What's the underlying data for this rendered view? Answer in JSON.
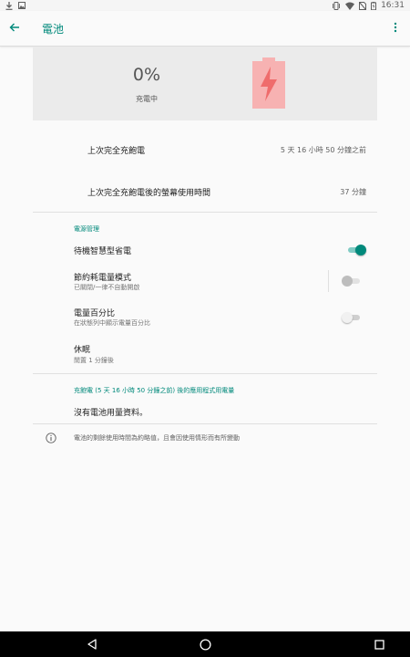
{
  "status_bar": {
    "time": "16:31",
    "icons_left": [
      "download-icon",
      "image-icon"
    ],
    "icons_right": [
      "vibrate-icon",
      "wifi-icon",
      "no-sim-icon",
      "battery-icon"
    ]
  },
  "app_bar": {
    "title": "電池",
    "accent_color": "#00897b"
  },
  "battery_header": {
    "percent": "0%",
    "status": "充電中",
    "icon": "battery-charging-icon",
    "level_fraction": 0
  },
  "usage": {
    "last_full_charge_label": "上次完全充飽電",
    "last_full_charge_value": "5 天 16 小時 50 分鐘之前",
    "screen_usage_label": "上次完全充飽電後的螢幕使用時間",
    "screen_usage_value": "37 分鐘"
  },
  "power_management": {
    "section_title": "電源管理",
    "items": [
      {
        "title": "待機智慧型省電",
        "summary": "",
        "switch": "on"
      },
      {
        "title": "節約耗電量模式",
        "summary": "已關閉/一律不自動開啟",
        "switch": "disabled"
      },
      {
        "title": "電量百分比",
        "summary": "在狀態列中顯示電量百分比",
        "switch": "off"
      },
      {
        "title": "休眠",
        "summary": "閒置 1 分鐘後",
        "switch": ""
      }
    ]
  },
  "app_usage": {
    "section_title": "充飽電 (5 天 16 小時 50 分鐘之前) 後的應用程式用電量",
    "empty_text": "沒有電池用量資料。"
  },
  "footer": {
    "info_text": "電池的剩餘使用時間為約略值，且會因使用情形而有所變動"
  },
  "nav_bar": {
    "buttons": [
      "back-nav-icon",
      "home-nav-icon",
      "recents-nav-icon"
    ]
  }
}
